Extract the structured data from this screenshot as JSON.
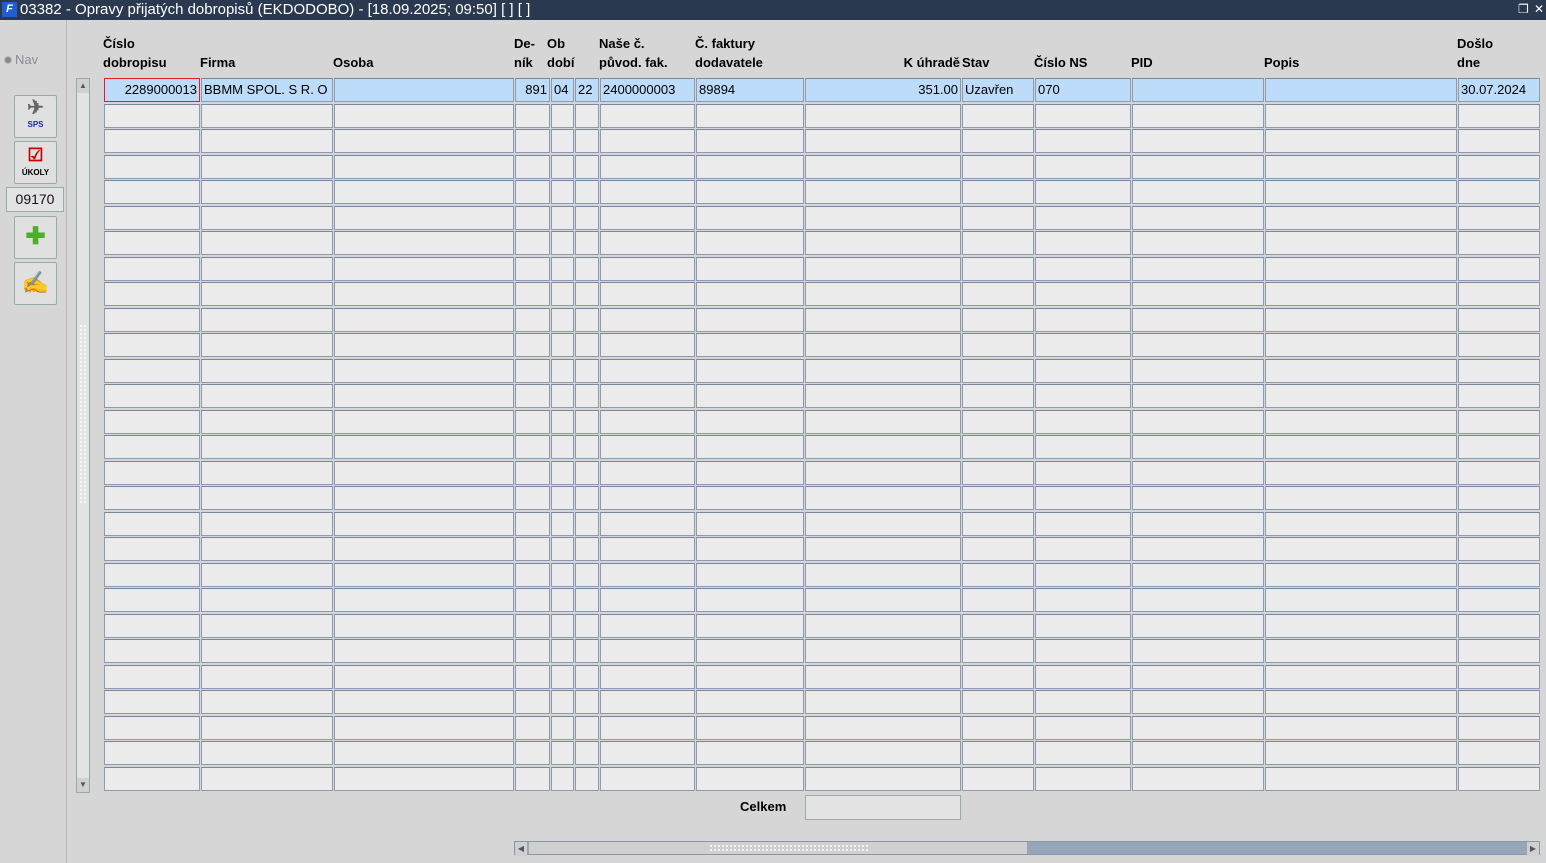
{
  "window": {
    "title": "03382 - Opravy přijatých dobropisů (EKDODOBO) - [18.09.2025; 09:50]  [ ] [ ]",
    "app_icon": "F"
  },
  "left_panel": {
    "nav_label": "Nav",
    "sps_label": "SPS",
    "ukoly_label": "ÚKOLY",
    "code": "09170"
  },
  "table": {
    "columns": [
      {
        "l1": "Číslo",
        "l2": "dobropisu"
      },
      {
        "l1": "",
        "l2": "Firma"
      },
      {
        "l1": "",
        "l2": "Osoba"
      },
      {
        "l1": "De-",
        "l2": "ník"
      },
      {
        "l1": "Ob",
        "l2": "dobí"
      },
      {
        "l1": "",
        "l2": ""
      },
      {
        "l1": "Naše č.",
        "l2": "původ. fak."
      },
      {
        "l1": "Č. faktury",
        "l2": "dodavatele"
      },
      {
        "l1": "",
        "l2": "K úhradě"
      },
      {
        "l1": "",
        "l2": "Stav"
      },
      {
        "l1": "",
        "l2": "Číslo NS"
      },
      {
        "l1": "",
        "l2": "PID"
      },
      {
        "l1": "",
        "l2": "Popis"
      },
      {
        "l1": "Došlo",
        "l2": "dne"
      }
    ],
    "rows": [
      [
        "2289000013",
        "BBMM SPOL. S R. O",
        "",
        "891",
        "04",
        "22",
        "2400000003",
        "89894",
        "351.00",
        "Uzavřen",
        "070",
        "",
        "",
        "30.07.2024"
      ]
    ],
    "total_rows": 28
  },
  "footer": {
    "total_label": "Celkem",
    "total_value": ""
  }
}
